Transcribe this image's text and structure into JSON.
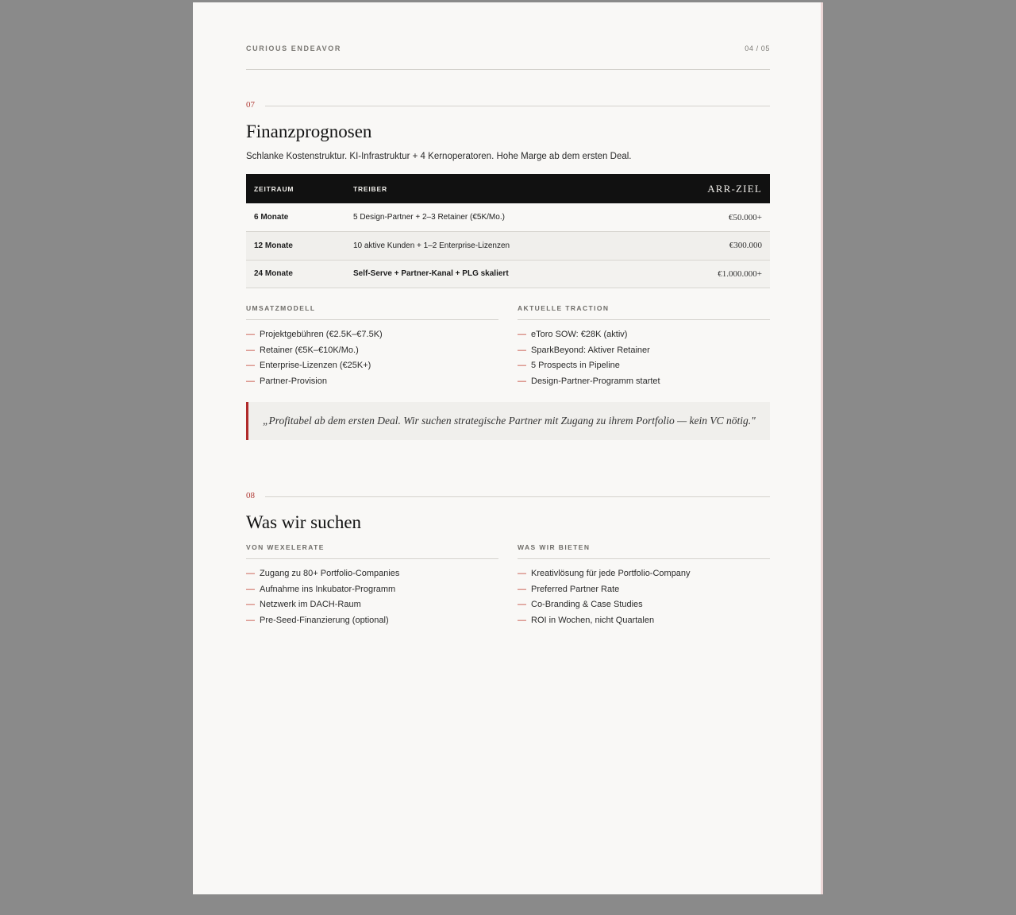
{
  "header": {
    "brand": "CURIOUS ENDEAVOR",
    "page": "04 / 05"
  },
  "section7": {
    "num": "07",
    "title": "Finanzprognosen",
    "intro": "Schlanke Kostenstruktur. KI-Infrastruktur + 4 Kernoperatoren. Hohe Marge ab dem ersten Deal.",
    "table": {
      "headers": {
        "period": "ZEITRAUM",
        "drivers": "TREIBER",
        "target": "ARR-ZIEL"
      },
      "rows": [
        {
          "period": "6 Monate",
          "drivers": "5 Design-Partner + 2–3 Retainer (€5K/Mo.)",
          "arr": "€50.000+"
        },
        {
          "period": "12 Monate",
          "drivers": "10 aktive Kunden + 1–2 Enterprise-Lizenzen",
          "arr": "€300.000"
        },
        {
          "period": "24 Monate",
          "drivers": "Self-Serve + Partner-Kanal + PLG skaliert",
          "arr": "€1.000.000+"
        }
      ]
    },
    "revenue": {
      "heading": "UMSATZMODELL",
      "items": [
        "Projektgebühren (€2.5K–€7.5K)",
        "Retainer (€5K–€10K/Mo.)",
        "Enterprise-Lizenzen (€25K+)",
        "Partner-Provision"
      ]
    },
    "traction": {
      "heading": "AKTUELLE TRACTION",
      "items": [
        "eToro SOW: €28K (aktiv)",
        "SparkBeyond: Aktiver Retainer",
        "5 Prospects in Pipeline",
        "Design-Partner-Programm startet"
      ]
    },
    "quote": "„Profitabel ab dem ersten Deal. Wir suchen strategische Partner mit Zugang zu ihrem Portfolio — kein VC nötig.\""
  },
  "section8": {
    "num": "08",
    "title": "Was wir suchen",
    "seek": {
      "heading": "VON WEXELERATE",
      "items": [
        "Zugang zu 80+ Portfolio-Companies",
        "Aufnahme ins Inkubator-Programm",
        "Netzwerk im DACH-Raum",
        "Pre-Seed-Finanzierung (optional)"
      ]
    },
    "offer": {
      "heading": "WAS WIR BIETEN",
      "items": [
        "Kreativlösung für jede Portfolio-Company",
        "Preferred Partner Rate",
        "Co-Branding & Case Studies",
        "ROI in Wochen, nicht Quartalen"
      ]
    },
    "dash": "—"
  }
}
